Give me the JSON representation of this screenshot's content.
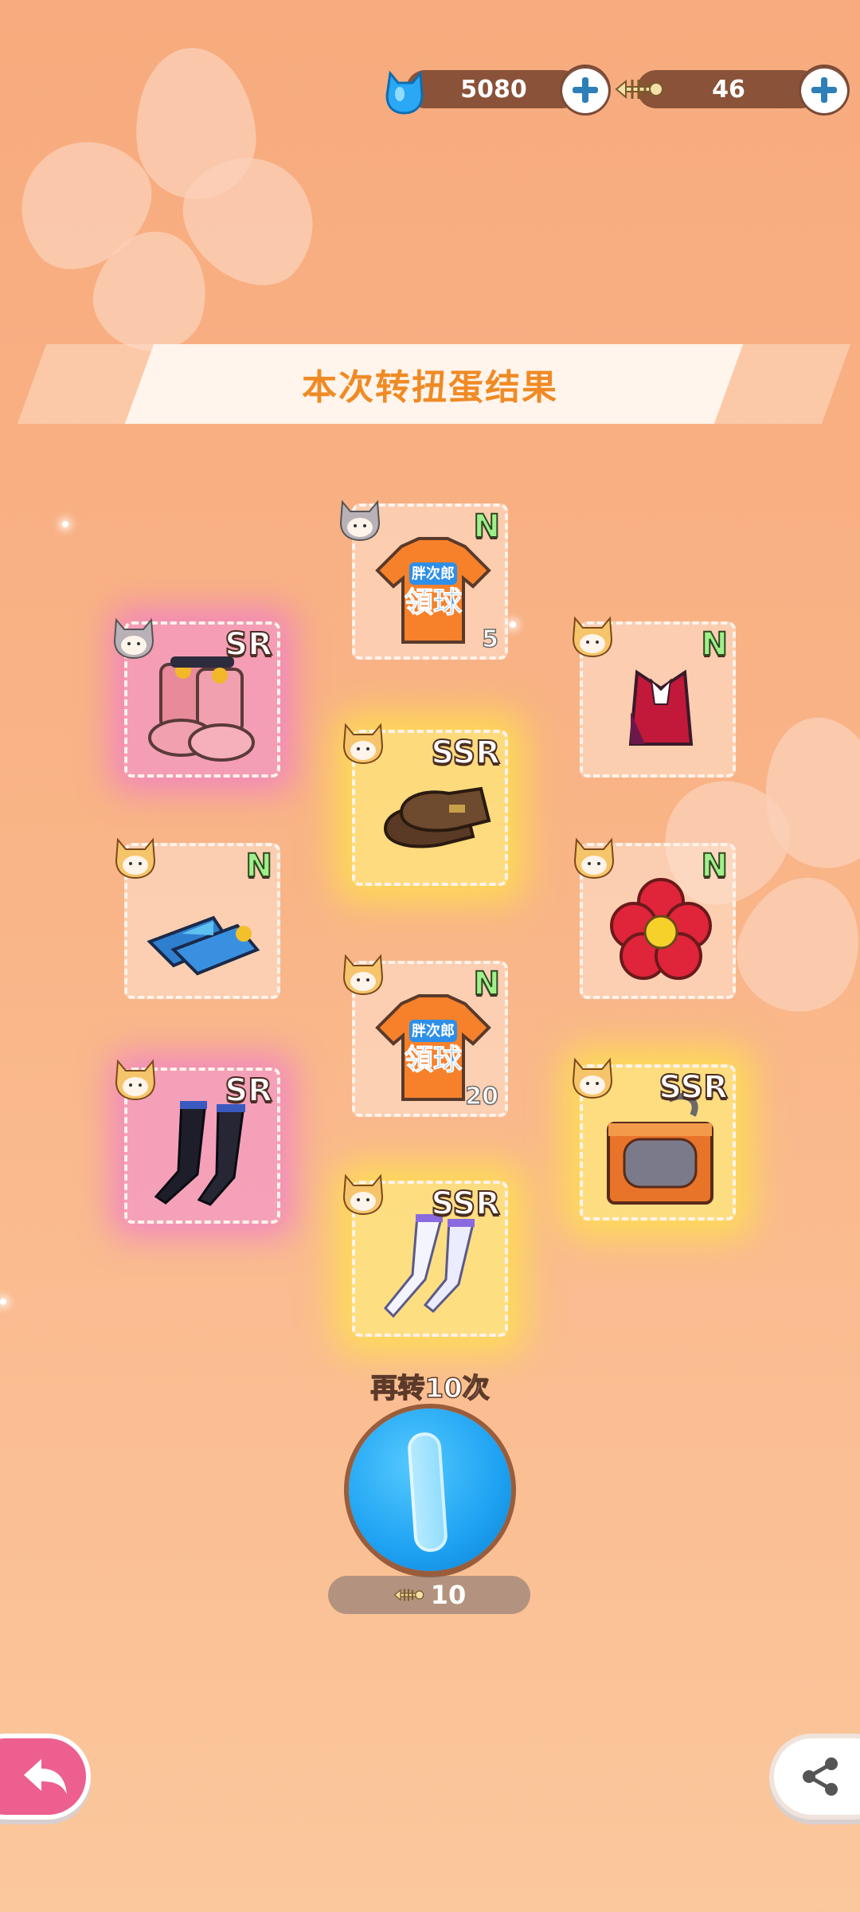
{
  "currency": {
    "gems": {
      "icon": "blue-cat-gem-icon",
      "value": "5080"
    },
    "fish": {
      "icon": "fish-bone-icon",
      "value": "46"
    }
  },
  "title": "本次转扭蛋结果",
  "results": [
    {
      "rarity": "N",
      "item": "orange-tshirt",
      "quantity": "5",
      "avatar": "gray-haired-cat-avatar"
    },
    {
      "rarity": "SR",
      "item": "pink-boots",
      "quantity": "",
      "avatar": "gray-haired-cat-avatar"
    },
    {
      "rarity": "N",
      "item": "red-vest",
      "quantity": "",
      "avatar": "blonde-cat-avatar"
    },
    {
      "rarity": "SSR",
      "item": "brown-mary-jane-shoes",
      "quantity": "",
      "avatar": "blonde-cat-avatar"
    },
    {
      "rarity": "N",
      "item": "blue-sandals",
      "quantity": "",
      "avatar": "blonde-cat-avatar"
    },
    {
      "rarity": "N",
      "item": "red-flower",
      "quantity": "",
      "avatar": "blonde-cat-avatar"
    },
    {
      "rarity": "N",
      "item": "orange-tshirt",
      "quantity": "20",
      "avatar": "blonde-cat-avatar"
    },
    {
      "rarity": "SR",
      "item": "black-stockings",
      "quantity": "",
      "avatar": "blonde-cat-avatar"
    },
    {
      "rarity": "SSR",
      "item": "orange-cat-cabinet",
      "quantity": "",
      "avatar": "blonde-cat-avatar"
    },
    {
      "rarity": "SSR",
      "item": "white-stockings",
      "quantity": "",
      "avatar": "blonde-cat-avatar"
    }
  ],
  "tshirt_text": {
    "line1": "胖次郎",
    "line2": "領球"
  },
  "spin": {
    "label": "再转10次",
    "cost": "10",
    "cost_icon": "fish-bone-icon"
  },
  "colors": {
    "gem": "#2aa8f5",
    "sr_glow": "#ec6edc",
    "ssr_glow": "#ffe646",
    "title": "#f08a25"
  }
}
